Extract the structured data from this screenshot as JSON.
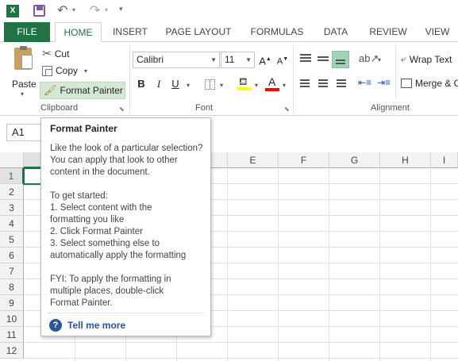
{
  "qat": {
    "excel_icon": "excel-logo-icon",
    "save_icon": "save-icon",
    "undo_icon": "undo-icon",
    "redo_icon": "redo-icon",
    "customize_icon": "customize-qat-icon"
  },
  "tabs": [
    {
      "label": "FILE"
    },
    {
      "label": "HOME"
    },
    {
      "label": "INSERT"
    },
    {
      "label": "PAGE LAYOUT"
    },
    {
      "label": "FORMULAS"
    },
    {
      "label": "DATA"
    },
    {
      "label": "REVIEW"
    },
    {
      "label": "VIEW"
    }
  ],
  "clipboard": {
    "paste_label": "Paste",
    "cut_label": "Cut",
    "copy_label": "Copy",
    "format_painter_label": "Format Painter",
    "group_label": "Clipboard"
  },
  "font": {
    "name": "Calibri",
    "size": "11",
    "group_label": "Font",
    "bold": "B",
    "italic": "I",
    "underline": "U",
    "grow": "A",
    "shrink": "A"
  },
  "alignment": {
    "wrap_text_label": "Wrap Text",
    "merge_label": "Merge & C",
    "group_label": "Alignment"
  },
  "namebox": {
    "value": "A1"
  },
  "grid": {
    "columns": [
      "",
      "",
      "",
      "",
      "E",
      "F",
      "G",
      "H",
      "I"
    ],
    "rows": [
      "1",
      "2",
      "3",
      "4",
      "5",
      "6",
      "7",
      "8",
      "9",
      "10",
      "11",
      "12"
    ]
  },
  "tooltip": {
    "title": "Format Painter",
    "p1": "Like the look of a particular selection? You can apply that look to other content in the document.",
    "started": "To get started:",
    "step1": "1. Select content with the formatting you like",
    "step2": "2. Click Format Painter",
    "step3": "3. Select something else to automatically apply the formatting",
    "fyi": "FYI: To apply the formatting in multiple places, double-click Format Painter.",
    "more": "Tell me more"
  },
  "colors": {
    "accent": "#217346",
    "link": "#2b579a",
    "highlight": "#ffff00",
    "font_red": "#ff0000"
  }
}
